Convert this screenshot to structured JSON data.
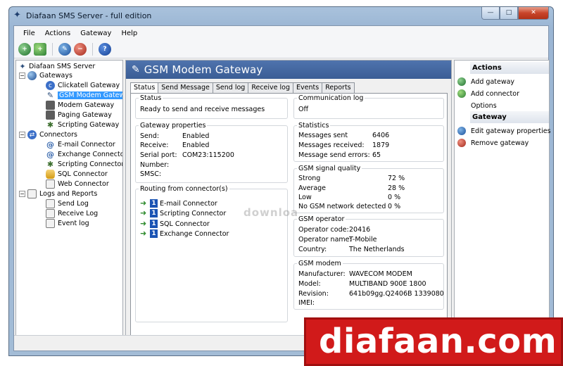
{
  "window": {
    "title": "Diafaan SMS Server - full edition"
  },
  "menu": [
    "File",
    "Actions",
    "Gateway",
    "Help"
  ],
  "tree": {
    "root": "Diafaan SMS Server",
    "gateways_label": "Gateways",
    "gateways": [
      "Clickatell Gateway",
      "GSM Modem Gateway",
      "Modem Gateway",
      "Paging Gateway",
      "Scripting Gateway"
    ],
    "connectors_label": "Connectors",
    "connectors": [
      "E-mail Connector",
      "Exchange Connector",
      "Scripting Connector",
      "SQL Connector",
      "Web Connector"
    ],
    "logs_label": "Logs and Reports",
    "logs": [
      "Send Log",
      "Receive Log",
      "Event log"
    ]
  },
  "center": {
    "header": "GSM Modem Gateway",
    "tabs": [
      "Status",
      "Send Message",
      "Send log",
      "Receive log",
      "Events",
      "Reports"
    ],
    "status": {
      "label": "Status",
      "text": "Ready to send and receive messages"
    },
    "comm_log": {
      "label": "Communication log",
      "text": "Off"
    },
    "gateway_props": {
      "label": "Gateway properties",
      "rows": [
        {
          "k": "Send:",
          "v": "Enabled"
        },
        {
          "k": "Receive:",
          "v": "Enabled"
        },
        {
          "k": "Serial port:",
          "v": "COM23:115200"
        },
        {
          "k": "Number:",
          "v": ""
        },
        {
          "k": "SMSC:",
          "v": ""
        }
      ]
    },
    "statistics": {
      "label": "Statistics",
      "rows": [
        {
          "k": "Messages sent",
          "v": "6406"
        },
        {
          "k": "Messages received:",
          "v": "1879"
        },
        {
          "k": "Message send errors:",
          "v": "65"
        }
      ]
    },
    "signal": {
      "label": "GSM signal quality",
      "rows": [
        {
          "k": "Strong",
          "v": "72 %"
        },
        {
          "k": "Average",
          "v": "28 %"
        },
        {
          "k": "Low",
          "v": "0 %"
        },
        {
          "k": "No GSM network detected",
          "v": "0 %"
        }
      ]
    },
    "operator": {
      "label": "GSM operator",
      "rows": [
        {
          "k": "Operator code:",
          "v": "20416"
        },
        {
          "k": "Operator name:",
          "v": "T-Mobile"
        },
        {
          "k": "Country:",
          "v": "The Netherlands"
        }
      ]
    },
    "modem": {
      "label": "GSM modem",
      "rows": [
        {
          "k": "Manufacturer:",
          "v": "WAVECOM MODEM"
        },
        {
          "k": "Model:",
          "v": "MULTIBAND  900E  1800"
        },
        {
          "k": "Revision:",
          "v": "641b09gg.Q2406B 1339080"
        },
        {
          "k": "IMEI:",
          "v": ""
        }
      ]
    },
    "routing": {
      "label": "Routing from connector(s)",
      "items": [
        {
          "num": "1",
          "name": "E-mail Connector"
        },
        {
          "num": "1",
          "name": "Scripting Connector"
        },
        {
          "num": "1",
          "name": "SQL Connector"
        },
        {
          "num": "1",
          "name": "Exchange Connector"
        }
      ]
    },
    "watermark": "downloa"
  },
  "actions": {
    "actions_label": "Actions",
    "actions_items": [
      "Add gateway",
      "Add connector",
      "Options"
    ],
    "gateway_label": "Gateway",
    "gateway_items": [
      "Edit gateway properties",
      "Remove gateway"
    ]
  },
  "brand": {
    "text": "diafaan.com"
  },
  "colors": {
    "header": "#3a5d95",
    "selection": "#3399ff",
    "brand": "#d11a1a"
  }
}
